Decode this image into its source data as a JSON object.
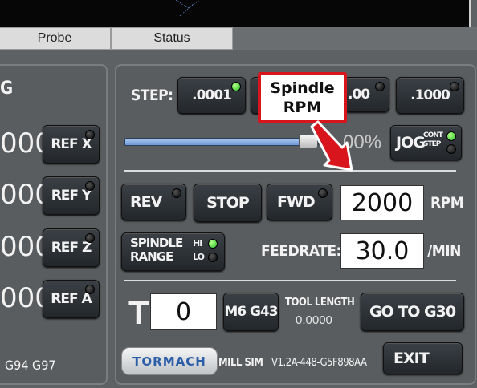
{
  "tabs": [
    {
      "label": "Probe"
    },
    {
      "label": "Status"
    }
  ],
  "left_panel": {
    "heading_fragment": "G",
    "dro_rows": [
      {
        "value_fragment": "000",
        "ref_label": "REF X"
      },
      {
        "value_fragment": "000",
        "ref_label": "REF Y"
      },
      {
        "value_fragment": "000",
        "ref_label": "REF Z"
      },
      {
        "value_fragment": "000",
        "ref_label": "REF A"
      }
    ],
    "gcodes": "G94  G97"
  },
  "step": {
    "label": "STEP:",
    "buttons": [
      {
        "label": ".0001"
      },
      {
        "label": ".00"
      },
      {
        "label": ".1000"
      }
    ],
    "slider_percent_fragment": "00%",
    "jog_label": "JOG",
    "jog_cont": "CONT",
    "jog_step": "STEP"
  },
  "callout": {
    "line1": "Spindle",
    "line2": "RPM"
  },
  "spindle": {
    "rev": "REV",
    "stop": "STOP",
    "fwd": "FWD",
    "rpm_value": "2000",
    "rpm_unit": "RPM",
    "range_label_1": "SPINDLE",
    "range_label_2": "RANGE",
    "range_hi": "HI",
    "range_lo": "LO"
  },
  "feed": {
    "label": "FEEDRATE:",
    "value": "30.0",
    "unit": "/MIN"
  },
  "tool": {
    "t_label": "T",
    "tool_number": "0",
    "m6g43": "M6 G43",
    "tool_length_label": "TOOL LENGTH",
    "tool_length_value": "0.0000",
    "go_g30": "GO TO G30"
  },
  "footer": {
    "logo": "TORMACH",
    "mill_sim": "MILL SIM",
    "version": "V1.2A-448-G5F898AA",
    "exit": "EXIT"
  },
  "colors": {
    "led_on": "#20c020",
    "callout_border": "#d8141c",
    "callout_arrow": "#d8141c"
  }
}
